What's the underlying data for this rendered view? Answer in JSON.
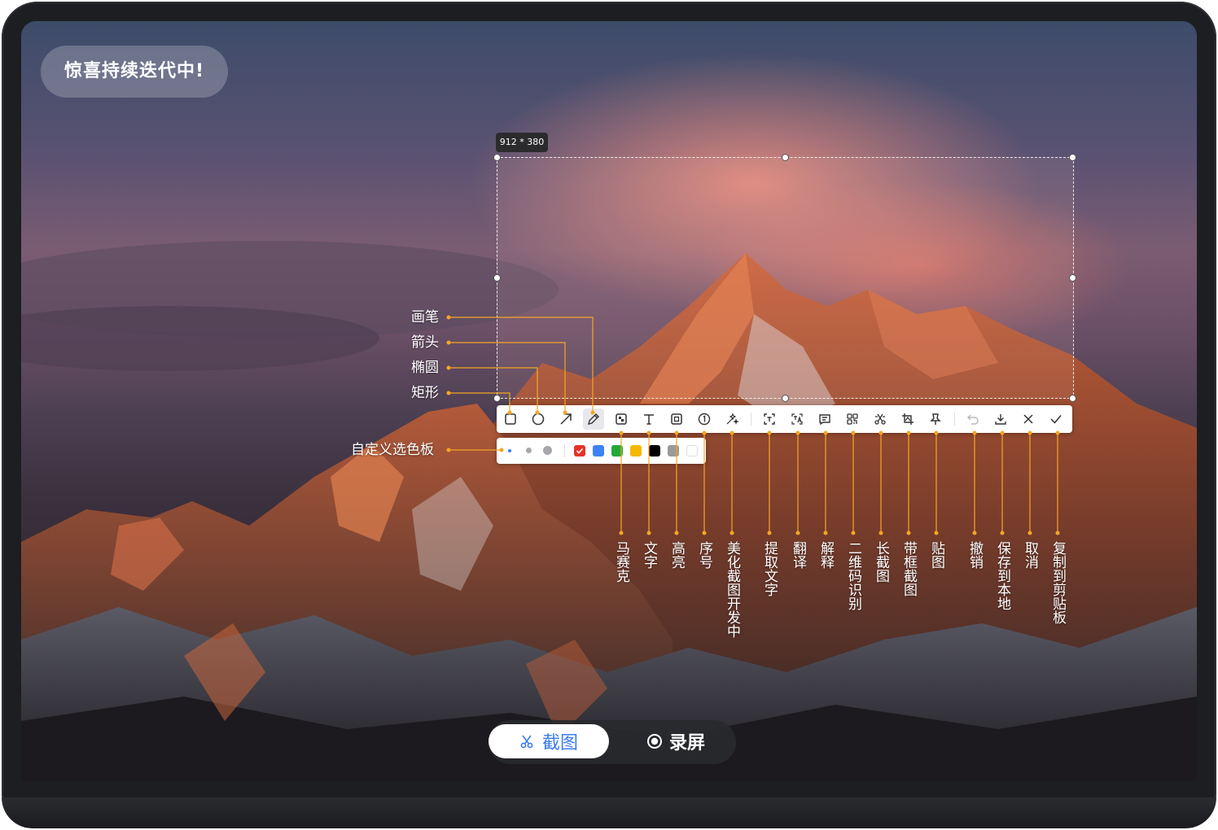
{
  "badge": {
    "text": "惊喜持续迭代中!"
  },
  "selection": {
    "size_label": "912 * 380"
  },
  "toolbar": {
    "tools": [
      {
        "icon": "rectangle-icon",
        "label": "矩形"
      },
      {
        "icon": "ellipse-icon",
        "label": "椭圆"
      },
      {
        "icon": "arrow-icon",
        "label": "箭头"
      },
      {
        "icon": "pen-icon",
        "label": "画笔",
        "active": true
      },
      {
        "icon": "mosaic-icon",
        "label": "马赛克"
      },
      {
        "icon": "text-icon",
        "label": "文字"
      },
      {
        "icon": "highlight-icon",
        "label": "高亮"
      },
      {
        "icon": "number-icon",
        "label": "序号"
      },
      {
        "icon": "beautify-icon",
        "label": "美化截图开发中"
      },
      {
        "icon": "ocr-icon",
        "label": "提取文字"
      },
      {
        "icon": "translate-icon",
        "label": "翻译"
      },
      {
        "icon": "explain-icon",
        "label": "解释"
      },
      {
        "icon": "qrcode-icon",
        "label": "二维码识别"
      },
      {
        "icon": "long-screenshot-icon",
        "label": "长截图"
      },
      {
        "icon": "frame-screenshot-icon",
        "label": "带框截图"
      },
      {
        "icon": "pin-icon",
        "label": "贴图"
      },
      {
        "icon": "undo-icon",
        "label": "撤销"
      },
      {
        "icon": "download-icon",
        "label": "保存到本地"
      },
      {
        "icon": "close-icon",
        "label": "取消"
      },
      {
        "icon": "check-icon",
        "label": "复制到剪贴板"
      }
    ]
  },
  "palette": {
    "label": "自定义选色板",
    "colors": [
      "#e5332a",
      "#3b82f6",
      "#22a83a",
      "#f5b800",
      "#000000",
      "#9a9a9a",
      "#ffffff"
    ],
    "selected_color": "#e5332a"
  },
  "annotations": {
    "pen": "画笔",
    "arrow": "箭头",
    "ellipse": "椭圆",
    "rectangle": "矩形",
    "palette": "自定义选色板",
    "mosaic": "马赛克",
    "text": "文字",
    "highlight": "高亮",
    "number": "序号",
    "beautify": "美化截图开发中",
    "ocr": "提取文字",
    "translate": "翻译",
    "explain": "解释",
    "qrcode": "二维码识别",
    "long": "长截图",
    "frame": "带框截图",
    "pin": "贴图",
    "undo": "撤销",
    "save": "保存到本地",
    "cancel": "取消",
    "copy": "复制到剪贴板"
  },
  "modes": {
    "capture_label": "截图",
    "record_label": "录屏",
    "active": "截图"
  }
}
